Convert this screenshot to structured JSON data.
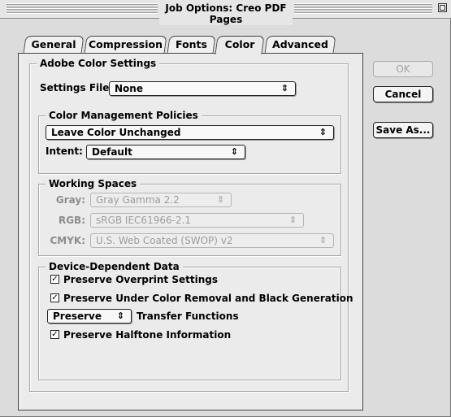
{
  "window": {
    "title": "Job Options: Creo PDF Pages"
  },
  "tabs": [
    {
      "label": "General"
    },
    {
      "label": "Compression"
    },
    {
      "label": "Fonts"
    },
    {
      "label": "Color"
    },
    {
      "label": "Advanced"
    }
  ],
  "active_tab": "Color",
  "adobe_color_settings": {
    "title": "Adobe Color Settings",
    "settings_file_label": "Settings File:",
    "settings_file_value": "None"
  },
  "color_management": {
    "title": "Color Management Policies",
    "policy_value": "Leave Color Unchanged",
    "intent_label": "Intent:",
    "intent_value": "Default"
  },
  "working_spaces": {
    "title": "Working Spaces",
    "gray_label": "Gray:",
    "gray_value": "Gray Gamma 2.2",
    "rgb_label": "RGB:",
    "rgb_value": "sRGB IEC61966-2.1",
    "cmyk_label": "CMYK:",
    "cmyk_value": "U.S. Web Coated (SWOP) v2"
  },
  "device_dependent": {
    "title": "Device-Dependent Data",
    "preserve_overprint": {
      "label": "Preserve Overprint Settings",
      "checked": true
    },
    "preserve_ucr": {
      "label": "Preserve Under Color Removal and Black Generation",
      "checked": true
    },
    "transfer_value": "Preserve",
    "transfer_label": "Transfer Functions",
    "preserve_halftone": {
      "label": "Preserve Halftone Information",
      "checked": true
    }
  },
  "buttons": {
    "ok": "OK",
    "cancel": "Cancel",
    "save_as": "Save As..."
  },
  "icons": {
    "popup_arrow": "⇕",
    "check_mark": "✓"
  }
}
